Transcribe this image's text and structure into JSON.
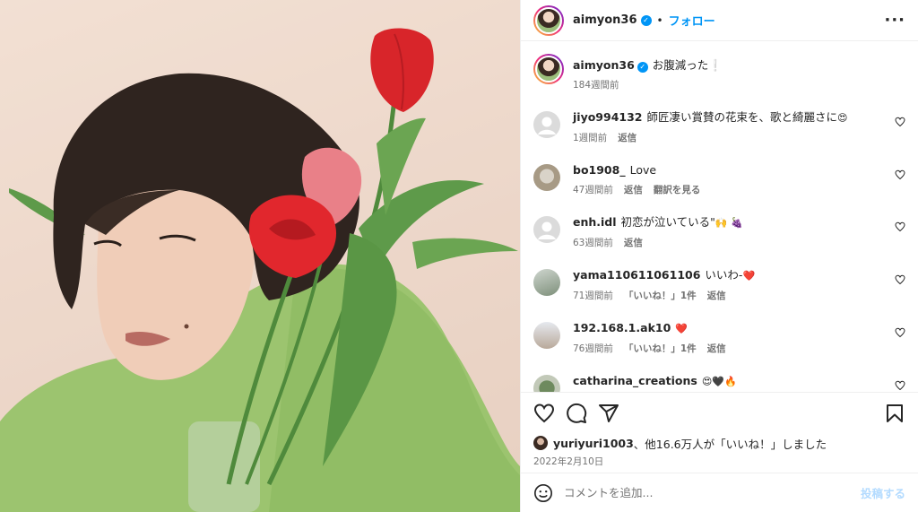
{
  "header": {
    "username": "aimyon36",
    "verified": true,
    "separator": "•",
    "follow_label": "フォロー",
    "more_icon": "more-horizontal-icon"
  },
  "caption": {
    "username": "aimyon36",
    "text": "お腹減った",
    "emoji": "❕",
    "time": "184週間前"
  },
  "comments": [
    {
      "username": "jiyo994132",
      "text": "師匠凄い賞賛の花束を、歌と綺麗さに",
      "emoji": "😍",
      "time": "1週間前",
      "actions": [
        "返信"
      ],
      "avatar": "default"
    },
    {
      "username": "bo1908_",
      "text": "Love",
      "emoji": "",
      "time": "47週間前",
      "actions": [
        "返信",
        "翻訳を見る"
      ],
      "avatar": "seal"
    },
    {
      "username": "enh.idl",
      "text": "初恋が泣いている\"",
      "emoji": "🙌 🍇",
      "time": "63週間前",
      "actions": [
        "返信"
      ],
      "avatar": "default"
    },
    {
      "username": "yama110611061106",
      "text": "いいわ-",
      "emoji": "❤️",
      "time": "71週間前",
      "actions": [
        "「いいね！」1件",
        "返信"
      ],
      "avatar": "photo"
    },
    {
      "username": "192.168.1.ak10",
      "text": "",
      "emoji": "❤️",
      "time": "76週間前",
      "actions": [
        "「いいね！」1件",
        "返信"
      ],
      "avatar": "photo2"
    },
    {
      "username": "catharina_creations",
      "text": "",
      "emoji": "😍🖤🔥",
      "time": "",
      "actions": [],
      "avatar": "plant"
    }
  ],
  "likes": {
    "user": "yuriyuri1003",
    "text": "、他16.6万人が「いいね！」しました"
  },
  "date": "2022年2月10日",
  "add_comment": {
    "placeholder": "コメントを追加...",
    "post_label": "投稿する"
  },
  "colors": {
    "accent": "#0095f6",
    "post_disabled": "#b3dbff",
    "meta": "#737373"
  }
}
